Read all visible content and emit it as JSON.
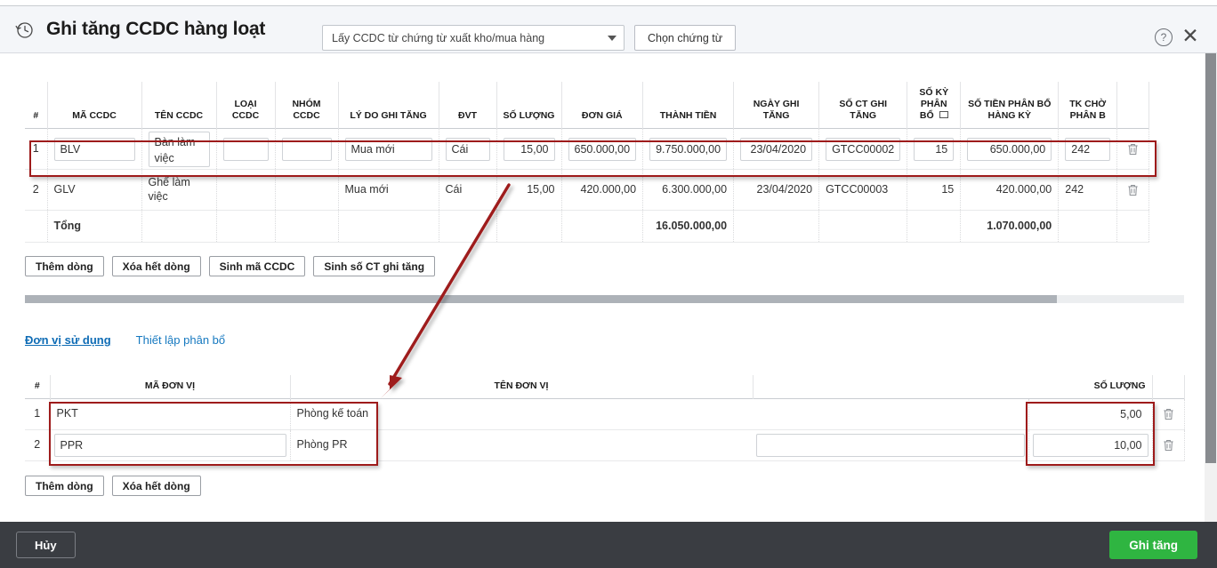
{
  "header": {
    "icon": "history-clock-icon",
    "title": "Ghi tăng CCDC hàng loạt",
    "source_select": {
      "value": "Lấy CCDC từ chứng từ xuất kho/mua hàng",
      "caret": "chevron-down-icon"
    },
    "choose_doc_button": "Chọn chứng từ",
    "help_icon": "?",
    "close_icon": "✕"
  },
  "asset_table": {
    "columns": [
      "#",
      "MÃ CCDC",
      "TÊN CCDC",
      "LOẠI CCDC",
      "NHÓM CCDC",
      "LÝ DO GHI TĂNG",
      "ĐVT",
      "SỐ LƯỢNG",
      "ĐƠN GIÁ",
      "THÀNH TIỀN",
      "NGÀY GHI TĂNG",
      "SỐ CT GHI TĂNG",
      "SỐ KỲ PHÂN BỔ",
      "SỐ TIỀN PHÂN BỔ HÀNG KỲ",
      "TK CHỜ PHÂN B"
    ],
    "rows": [
      {
        "index": "1",
        "ma_ccdc": "BLV",
        "ten_ccdc": "Bàn làm việc",
        "loai_ccdc": "",
        "nhom_ccdc": "",
        "ly_do": "Mua mới",
        "dvt": "Cái",
        "so_luong": "15,00",
        "don_gia": "650.000,00",
        "thanh_tien": "9.750.000,00",
        "ngay_ghi_tang": "23/04/2020",
        "so_ct": "GTCC00002",
        "so_ky": "15",
        "so_tien_phan_bo": "650.000,00",
        "tk_cho": "242",
        "delete_icon": "trash-icon"
      },
      {
        "index": "2",
        "ma_ccdc": "GLV",
        "ten_ccdc": "Ghế làm việc",
        "loai_ccdc": "",
        "nhom_ccdc": "",
        "ly_do": "Mua mới",
        "dvt": "Cái",
        "so_luong": "15,00",
        "don_gia": "420.000,00",
        "thanh_tien": "6.300.000,00",
        "ngay_ghi_tang": "23/04/2020",
        "so_ct": "GTCC00003",
        "so_ky": "15",
        "so_tien_phan_bo": "420.000,00",
        "tk_cho": "242",
        "delete_icon": "trash-icon"
      }
    ],
    "total": {
      "label": "Tổng",
      "thanh_tien": "16.050.000,00",
      "so_tien_phan_bo": "1.070.000,00"
    }
  },
  "asset_toolbar": {
    "add_row": "Thêm dòng",
    "delete_all": "Xóa hết dòng",
    "gen_code": "Sinh mã CCDC",
    "gen_doc_no": "Sinh số CT ghi tăng"
  },
  "tabs": [
    {
      "label": "Đơn vị sử dụng",
      "active": true
    },
    {
      "label": "Thiết lập phân bổ",
      "active": false
    }
  ],
  "unit_table": {
    "columns": [
      "#",
      "MÃ ĐƠN VỊ",
      "TÊN ĐƠN VỊ",
      "",
      "SỐ LƯỢNG"
    ],
    "rows": [
      {
        "index": "1",
        "ma_don_vi": "PKT",
        "ten_don_vi": "Phòng kế toán",
        "blank": "",
        "so_luong": "5,00",
        "delete_icon": "trash-icon"
      },
      {
        "index": "2",
        "ma_don_vi": "PPR",
        "ten_don_vi": "Phòng PR",
        "blank": "",
        "so_luong": "10,00",
        "delete_icon": "trash-icon"
      }
    ]
  },
  "unit_toolbar": {
    "add_row": "Thêm dòng",
    "delete_all": "Xóa hết dòng"
  },
  "footer": {
    "cancel": "Hủy",
    "submit": "Ghi tăng"
  },
  "annotation": {
    "color": "#9e1b1b",
    "arrow": "red-arrow-annotation"
  }
}
